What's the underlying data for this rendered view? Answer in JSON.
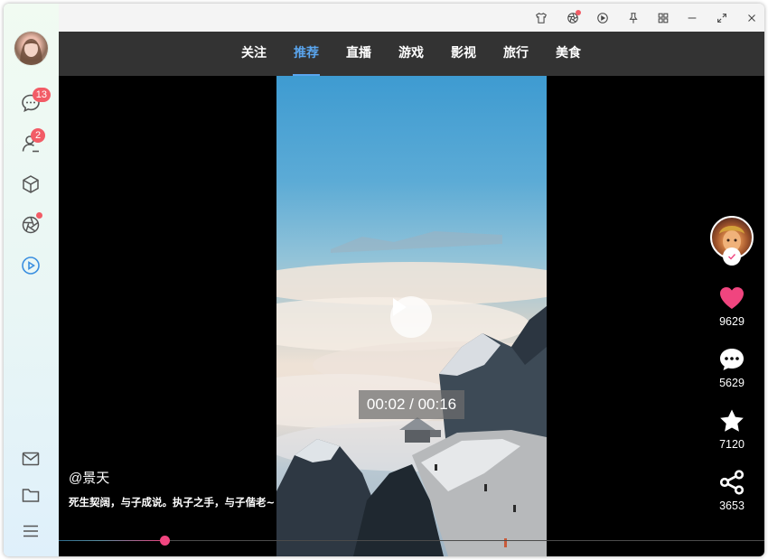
{
  "sidebar": {
    "messages_badge": "13",
    "contacts_badge": "2",
    "icons": [
      "avatar",
      "chat-icon",
      "contacts-icon",
      "cube-icon",
      "camera-aperture-icon",
      "play-circle-icon",
      "mail-icon",
      "folder-icon",
      "menu-icon"
    ]
  },
  "titlebar": {
    "icons": [
      "shirt-icon",
      "camera-aperture-icon",
      "play-circle-icon",
      "pin-icon",
      "grid-icon",
      "minimize-icon",
      "maximize-icon",
      "close-icon"
    ]
  },
  "nav": {
    "tabs": [
      {
        "label": "关注"
      },
      {
        "label": "推荐"
      },
      {
        "label": "直播"
      },
      {
        "label": "游戏"
      },
      {
        "label": "影视"
      },
      {
        "label": "旅行"
      },
      {
        "label": "美食"
      }
    ],
    "active_index": 1
  },
  "video": {
    "timecode": "00:02 / 00:16",
    "author": "@景天",
    "caption": "死生契阔，与子成说。执子之手，与子偕老~",
    "progress_fraction": 0.15
  },
  "actions": {
    "likes": "9629",
    "comments": "5629",
    "favorites": "7120",
    "shares": "3653"
  },
  "colors": {
    "accent": "#5aa5ee",
    "like": "#f0457f",
    "badge": "#f25c66",
    "sidebar_icon": "#555555",
    "sidebar_active": "#3b8fe0"
  }
}
